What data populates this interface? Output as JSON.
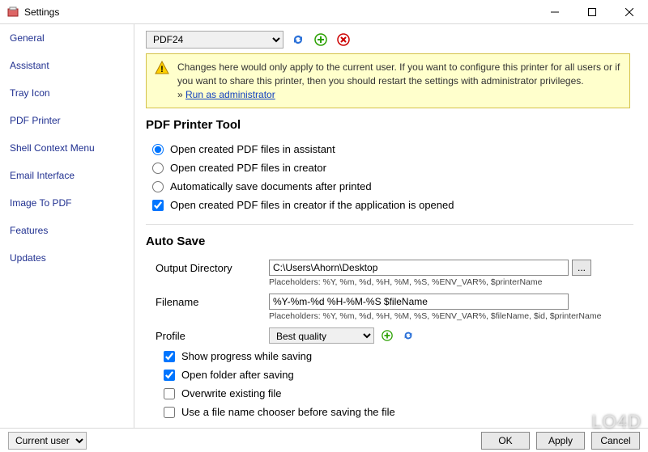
{
  "window": {
    "title": "Settings"
  },
  "sidebar": {
    "items": [
      {
        "label": "General"
      },
      {
        "label": "Assistant"
      },
      {
        "label": "Tray Icon"
      },
      {
        "label": "PDF Printer"
      },
      {
        "label": "Shell Context Menu"
      },
      {
        "label": "Email Interface"
      },
      {
        "label": "Image To PDF"
      },
      {
        "label": "Features"
      },
      {
        "label": "Updates"
      }
    ]
  },
  "top": {
    "printer_selected": "PDF24"
  },
  "warning": {
    "text": "Changes here would only apply to the current user. If you want to configure this printer for all users or if you want to share this printer, then you should restart the settings with administrator privileges.",
    "link_prefix": "» ",
    "link": "Run as administrator"
  },
  "pdf_tool": {
    "title": "PDF Printer Tool",
    "radios": [
      {
        "label": "Open created PDF files in assistant",
        "checked": true
      },
      {
        "label": "Open created PDF files in creator",
        "checked": false
      },
      {
        "label": "Automatically save documents after printed",
        "checked": false
      }
    ],
    "check_open_in_creator": {
      "label": "Open created PDF files in creator if the application is opened",
      "checked": true
    }
  },
  "autosave": {
    "title": "Auto Save",
    "output_dir_label": "Output Directory",
    "output_dir_value": "C:\\Users\\Ahorn\\Desktop",
    "output_dir_placeholders": "Placeholders: %Y, %m, %d, %H, %M, %S, %ENV_VAR%, $printerName",
    "browse_label": "...",
    "filename_label": "Filename",
    "filename_value": "%Y-%m-%d %H-%M-%S $fileName",
    "filename_placeholders": "Placeholders: %Y, %m, %d, %H, %M, %S, %ENV_VAR%, $fileName, $id, $printerName",
    "profile_label": "Profile",
    "profile_selected": "Best quality",
    "checks": [
      {
        "label": "Show progress while saving",
        "checked": true
      },
      {
        "label": "Open folder after saving",
        "checked": true
      },
      {
        "label": "Overwrite existing file",
        "checked": false
      },
      {
        "label": "Use a file name chooser before saving the file",
        "checked": false
      }
    ]
  },
  "footer": {
    "scope_selected": "Current user",
    "ok": "OK",
    "apply": "Apply",
    "cancel": "Cancel"
  }
}
